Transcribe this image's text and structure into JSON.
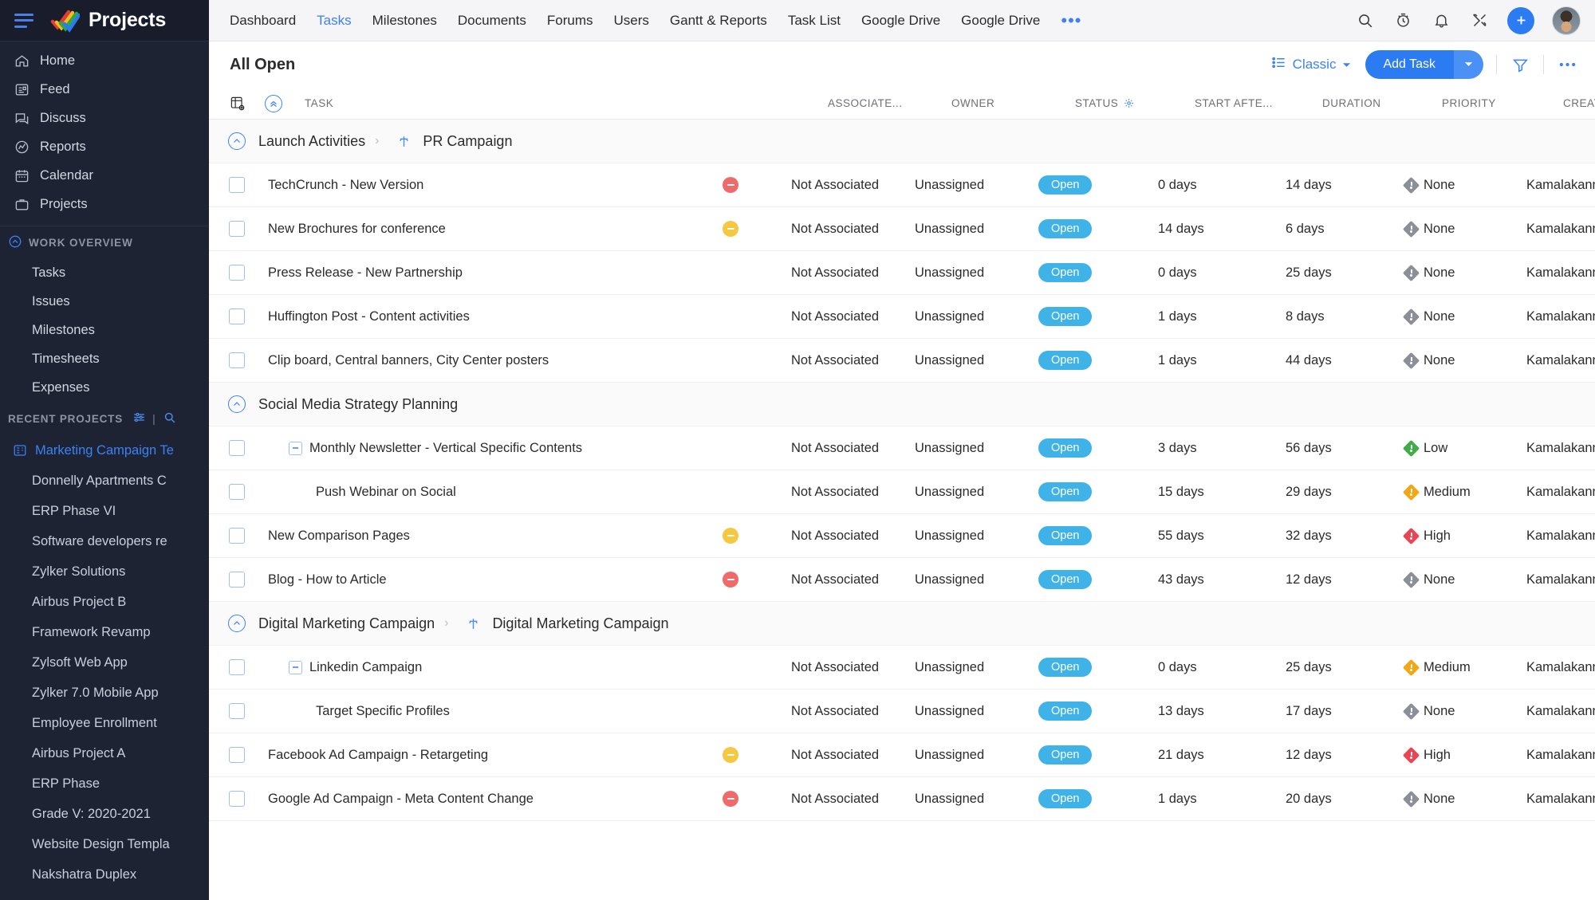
{
  "brand": {
    "name": "Projects",
    "logo_icon": "zoho-projects-logo",
    "menu_icon": "hamburger-menu-icon"
  },
  "sidebar": {
    "primary_items": [
      {
        "label": "Home",
        "icon": "home-icon"
      },
      {
        "label": "Feed",
        "icon": "feed-icon"
      },
      {
        "label": "Discuss",
        "icon": "discuss-icon"
      },
      {
        "label": "Reports",
        "icon": "reports-icon"
      },
      {
        "label": "Calendar",
        "icon": "calendar-icon"
      },
      {
        "label": "Projects",
        "icon": "projects-icon"
      }
    ],
    "work_overview": {
      "title": "WORK OVERVIEW",
      "collapse_icon": "chevron-up-circle-icon",
      "items": [
        {
          "label": "Tasks"
        },
        {
          "label": "Issues"
        },
        {
          "label": "Milestones"
        },
        {
          "label": "Timesheets"
        },
        {
          "label": "Expenses"
        }
      ]
    },
    "recent_projects": {
      "title": "RECENT PROJECTS",
      "filter_icon": "sliders-icon",
      "divider": "|",
      "search_icon": "search-icon",
      "items": [
        {
          "label": "Marketing Campaign Te",
          "active": true,
          "icon": "project-board-icon"
        },
        {
          "label": "Donnelly Apartments C",
          "active": false
        },
        {
          "label": "ERP Phase VI",
          "active": false
        },
        {
          "label": "Software developers re",
          "active": false
        },
        {
          "label": "Zylker Solutions",
          "active": false
        },
        {
          "label": "Airbus Project B",
          "active": false
        },
        {
          "label": "Framework Revamp",
          "active": false
        },
        {
          "label": "Zylsoft Web App",
          "active": false
        },
        {
          "label": "Zylker 7.0 Mobile App",
          "active": false
        },
        {
          "label": "Employee Enrollment",
          "active": false
        },
        {
          "label": "Airbus Project A",
          "active": false
        },
        {
          "label": "ERP Phase",
          "active": false
        },
        {
          "label": "Grade V: 2020-2021",
          "active": false
        },
        {
          "label": "Website Design Templa",
          "active": false
        },
        {
          "label": "Nakshatra Duplex",
          "active": false
        }
      ]
    }
  },
  "topbar": {
    "tabs": [
      {
        "label": "Dashboard",
        "active": false
      },
      {
        "label": "Tasks",
        "active": true
      },
      {
        "label": "Milestones",
        "active": false
      },
      {
        "label": "Documents",
        "active": false
      },
      {
        "label": "Forums",
        "active": false
      },
      {
        "label": "Users",
        "active": false
      },
      {
        "label": "Gantt & Reports",
        "active": false
      },
      {
        "label": "Task List",
        "active": false
      },
      {
        "label": "Google Drive",
        "active": false
      },
      {
        "label": "Google Drive",
        "active": false
      }
    ],
    "more_tabs_icon": "ellipsis-icon",
    "icons": [
      {
        "name": "search-icon"
      },
      {
        "name": "timer-icon"
      },
      {
        "name": "notification-bell-icon"
      },
      {
        "name": "tools-icon"
      }
    ],
    "add_button_icon": "plus-icon",
    "avatar": "user-avatar"
  },
  "toolbar": {
    "title": "All Open",
    "view_label": "Classic",
    "view_icon": "list-view-icon",
    "view_caret_icon": "chevron-down-icon",
    "add_task_label": "Add Task",
    "add_task_caret_icon": "chevron-down-icon",
    "filter_icon": "funnel-filter-icon",
    "more_icon": "ellipsis-icon"
  },
  "table": {
    "header_icons": {
      "column_settings": "column-settings-icon",
      "collapse_all": "collapse-all-icon"
    },
    "columns": [
      {
        "key": "task",
        "label": "TASK"
      },
      {
        "key": "associate",
        "label": "ASSOCIATE..."
      },
      {
        "key": "owner",
        "label": "OWNER"
      },
      {
        "key": "status",
        "label": "STATUS",
        "gear_icon": "gear-icon"
      },
      {
        "key": "start",
        "label": "START AFTE..."
      },
      {
        "key": "duration",
        "label": "DURATION"
      },
      {
        "key": "priority",
        "label": "PRIORITY"
      },
      {
        "key": "created_by",
        "label": "CREATED BY"
      }
    ],
    "groups": [
      {
        "title": "Launch Activities",
        "separator": "›",
        "milestone": "PR Campaign",
        "milestone_icon": "milestone-flag-icon",
        "collapse_icon": "chevron-up-circle-icon",
        "rows": [
          {
            "task": "TechCrunch - New Version",
            "indent": 0,
            "expand": false,
            "assoc_dot": "red",
            "associate": "Not Associated",
            "owner": "Unassigned",
            "status": "Open",
            "start": "0 days",
            "duration": "14 days",
            "priority": "None",
            "priority_color": "#8a8f99",
            "created_by": "Kamalakannan B"
          },
          {
            "task": "New Brochures for conference",
            "indent": 0,
            "expand": false,
            "assoc_dot": "yellow",
            "associate": "Not Associated",
            "owner": "Unassigned",
            "status": "Open",
            "start": "14 days",
            "duration": "6 days",
            "priority": "None",
            "priority_color": "#8a8f99",
            "created_by": "Kamalakannan B"
          },
          {
            "task": "Press Release - New Partnership",
            "indent": 0,
            "expand": false,
            "assoc_dot": "none",
            "associate": "Not Associated",
            "owner": "Unassigned",
            "status": "Open",
            "start": "0 days",
            "duration": "25 days",
            "priority": "None",
            "priority_color": "#8a8f99",
            "created_by": "Kamalakannan B"
          },
          {
            "task": "Huffington Post - Content activities",
            "indent": 0,
            "expand": false,
            "assoc_dot": "none",
            "associate": "Not Associated",
            "owner": "Unassigned",
            "status": "Open",
            "start": "1 days",
            "duration": "8 days",
            "priority": "None",
            "priority_color": "#8a8f99",
            "created_by": "Kamalakannan B"
          },
          {
            "task": "Clip board, Central banners, City Center posters",
            "indent": 0,
            "expand": false,
            "assoc_dot": "none",
            "associate": "Not Associated",
            "owner": "Unassigned",
            "status": "Open",
            "start": "1 days",
            "duration": "44 days",
            "priority": "None",
            "priority_color": "#8a8f99",
            "created_by": "Kamalakannan B"
          }
        ]
      },
      {
        "title": "Social Media Strategy Planning",
        "separator": "",
        "milestone": "",
        "milestone_icon": "",
        "collapse_icon": "chevron-up-circle-icon",
        "rows": [
          {
            "task": "Monthly Newsletter - Vertical Specific Contents",
            "indent": 1,
            "expand": true,
            "assoc_dot": "none",
            "associate": "Not Associated",
            "owner": "Unassigned",
            "status": "Open",
            "start": "3 days",
            "duration": "56 days",
            "priority": "Low",
            "priority_color": "#41ad49",
            "created_by": "Kamalakannan B"
          },
          {
            "task": "Push Webinar on Social",
            "indent": 2,
            "expand": false,
            "assoc_dot": "none",
            "associate": "Not Associated",
            "owner": "Unassigned",
            "status": "Open",
            "start": "15 days",
            "duration": "29 days",
            "priority": "Medium",
            "priority_color": "#f3a712",
            "created_by": "Kamalakannan B"
          },
          {
            "task": "New Comparison Pages",
            "indent": 0,
            "expand": false,
            "assoc_dot": "yellow",
            "associate": "Not Associated",
            "owner": "Unassigned",
            "status": "Open",
            "start": "55 days",
            "duration": "32 days",
            "priority": "High",
            "priority_color": "#ef4352",
            "created_by": "Kamalakannan B"
          },
          {
            "task": "Blog - How to Article",
            "indent": 0,
            "expand": false,
            "assoc_dot": "red",
            "associate": "Not Associated",
            "owner": "Unassigned",
            "status": "Open",
            "start": "43 days",
            "duration": "12 days",
            "priority": "None",
            "priority_color": "#8a8f99",
            "created_by": "Kamalakannan B"
          }
        ]
      },
      {
        "title": "Digital Marketing Campaign",
        "separator": "›",
        "milestone": "Digital Marketing Campaign",
        "milestone_icon": "milestone-flag-icon",
        "collapse_icon": "chevron-up-circle-icon",
        "rows": [
          {
            "task": "Linkedin Campaign",
            "indent": 1,
            "expand": true,
            "assoc_dot": "none",
            "associate": "Not Associated",
            "owner": "Unassigned",
            "status": "Open",
            "start": "0 days",
            "duration": "25 days",
            "priority": "Medium",
            "priority_color": "#f3a712",
            "created_by": "Kamalakannan B"
          },
          {
            "task": "Target Specific Profiles",
            "indent": 2,
            "expand": false,
            "assoc_dot": "none",
            "associate": "Not Associated",
            "owner": "Unassigned",
            "status": "Open",
            "start": "13 days",
            "duration": "17 days",
            "priority": "None",
            "priority_color": "#8a8f99",
            "created_by": "Kamalakannan B"
          },
          {
            "task": "Facebook Ad Campaign - Retargeting",
            "indent": 0,
            "expand": false,
            "assoc_dot": "yellow",
            "associate": "Not Associated",
            "owner": "Unassigned",
            "status": "Open",
            "start": "21 days",
            "duration": "12 days",
            "priority": "High",
            "priority_color": "#ef4352",
            "created_by": "Kamalakannan B"
          },
          {
            "task": "Google Ad Campaign - Meta Content Change",
            "indent": 0,
            "expand": false,
            "assoc_dot": "red",
            "associate": "Not Associated",
            "owner": "Unassigned",
            "status": "Open",
            "start": "1 days",
            "duration": "20 days",
            "priority": "None",
            "priority_color": "#8a8f99",
            "created_by": "Kamalakannan B"
          }
        ]
      }
    ]
  },
  "colors": {
    "accent_blue": "#2b7cf3",
    "sidebar_bg": "#1e2333",
    "status_badge": "#3fb3e8",
    "assoc_red": "#ef6b6b",
    "assoc_yellow": "#f5c842"
  }
}
